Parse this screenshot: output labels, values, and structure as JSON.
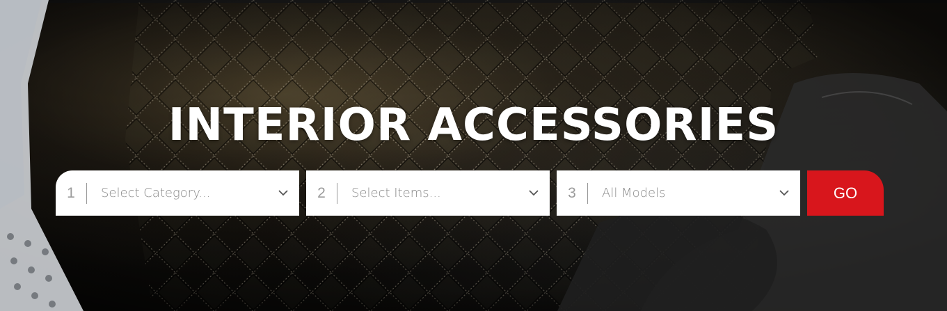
{
  "hero": {
    "title": "INTERIOR ACCESSORIES"
  },
  "finder": {
    "steps": [
      {
        "number": "1",
        "label": "Select Category..."
      },
      {
        "number": "2",
        "label": "Select Items..."
      },
      {
        "number": "3",
        "label": "All Models"
      }
    ],
    "go_label": "GO",
    "chevron_icon": "chevron-down-icon"
  },
  "colors": {
    "accent": "#d8161c",
    "title": "#ffffff",
    "placeholder": "#8a8a8a"
  }
}
